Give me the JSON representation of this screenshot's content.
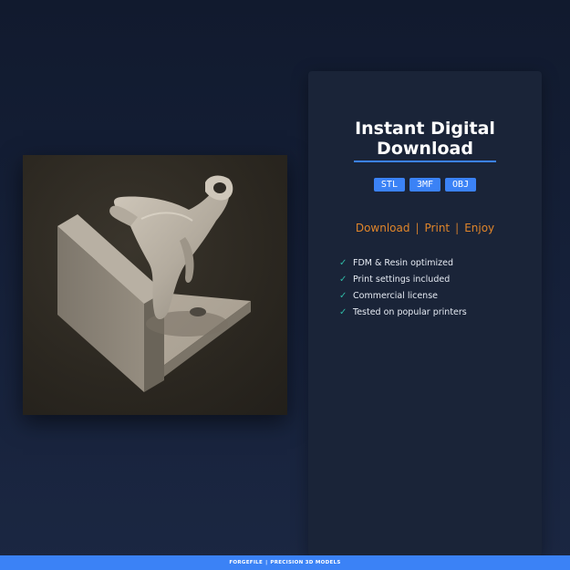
{
  "panel": {
    "title_line1": "Instant Digital",
    "title_line2": "Download",
    "formats": [
      "STL",
      "3MF",
      "OBJ"
    ],
    "tagline": [
      "Download",
      "Print",
      "Enjoy"
    ],
    "tagline_separator": "|",
    "features": [
      "FDM & Resin optimized",
      "Print settings included",
      "Commercial license",
      "Tested on popular printers"
    ],
    "check_glyph": "✓"
  },
  "footer": {
    "brand": "FORGEFILE",
    "separator": "|",
    "tagline": "PRECISION 3D MODELS"
  },
  "colors": {
    "accent": "#3b82f6",
    "tagline": "#e0852a",
    "check": "#2fb7a4",
    "panel_bg": "#1a2438",
    "page_bg": "#111a2e"
  },
  "icons": {
    "check": "check-icon",
    "product": "3d-model-render-image"
  }
}
